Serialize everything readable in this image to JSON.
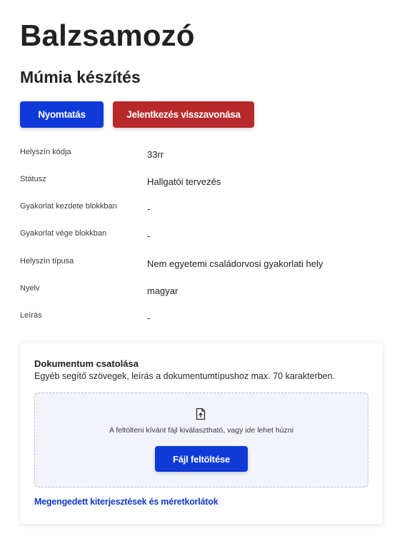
{
  "header": {
    "title": "Balzsamozó",
    "subtitle": "Múmia készítés"
  },
  "actions": {
    "print_label": "Nyomtatás",
    "withdraw_label": "Jelentkezés visszavonása"
  },
  "details": [
    {
      "label": "Helyszín kódja",
      "value": "33rr"
    },
    {
      "label": "Státusz",
      "value": "Hallgatói tervezés"
    },
    {
      "label": "Gyakorlat kezdete blokkban",
      "value": "-"
    },
    {
      "label": "Gyakorlat vége blokkban",
      "value": "-"
    },
    {
      "label": "Helyszín típusa",
      "value": "Nem egyetemi családorvosi gyakorlati hely"
    },
    {
      "label": "Nyelv",
      "value": "magyar"
    },
    {
      "label": "Leírás",
      "value": "-"
    }
  ],
  "attachment": {
    "title": "Dokumentum csatolása",
    "description": "Egyéb segítő szövegek, leírás a dokumentumtípushoz max. 70 karakterben.",
    "dropzone_text": "A feltölteni kívánt fájl kiválasztható, vagy ide lehet húzni",
    "upload_label": "Fájl feltöltése",
    "upload_icon": "file-upload-icon",
    "limits_link": "Megengedett kiterjesztések és méretkorlátok"
  },
  "colors": {
    "primary": "#0f3ad8",
    "danger": "#b82a2a",
    "link": "#1237c9",
    "dropzone_bg": "#f3f4fb"
  }
}
